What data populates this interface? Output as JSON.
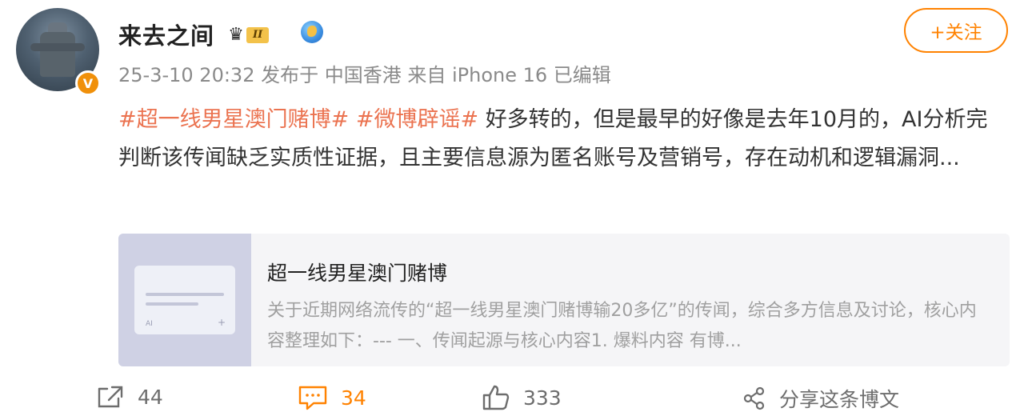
{
  "post": {
    "username": "来去之间",
    "level_badge": "II",
    "meta": "25-3-10 20:32 发布于 中国香港 来自 iPhone 16 已编辑",
    "follow_label": "+关注",
    "hashtags": [
      "#超一线男星澳门赌博#",
      "#微博辟谣#"
    ],
    "text": " 好多转的，但是最早的好像是去年10月的，AI分析完判断该传闻缺乏实质性证据，且主要信息源为匿名账号及营销号，存在动机和逻辑漏洞..."
  },
  "card": {
    "thumb_ai": "AI",
    "thumb_plus": "+",
    "title": "超一线男星澳门赌博",
    "description": "关于近期网络流传的“超一线男星澳门赌博输20多亿”的传闻，综合多方信息及讨论，核心内容整理如下：--- 一、传闻起源与核心内容1. 爆料内容 有博..."
  },
  "actions": {
    "forward_count": "44",
    "comment_count": "34",
    "like_count": "333",
    "share_label": "分享这条博文"
  },
  "colors": {
    "accent": "#ff8200",
    "hashtag": "#eb7350",
    "meta_text": "#8a8a8a"
  },
  "icons": [
    "verified-icon",
    "crown-icon",
    "globe-icon",
    "forward-icon",
    "comment-icon",
    "like-icon",
    "share-icon"
  ]
}
